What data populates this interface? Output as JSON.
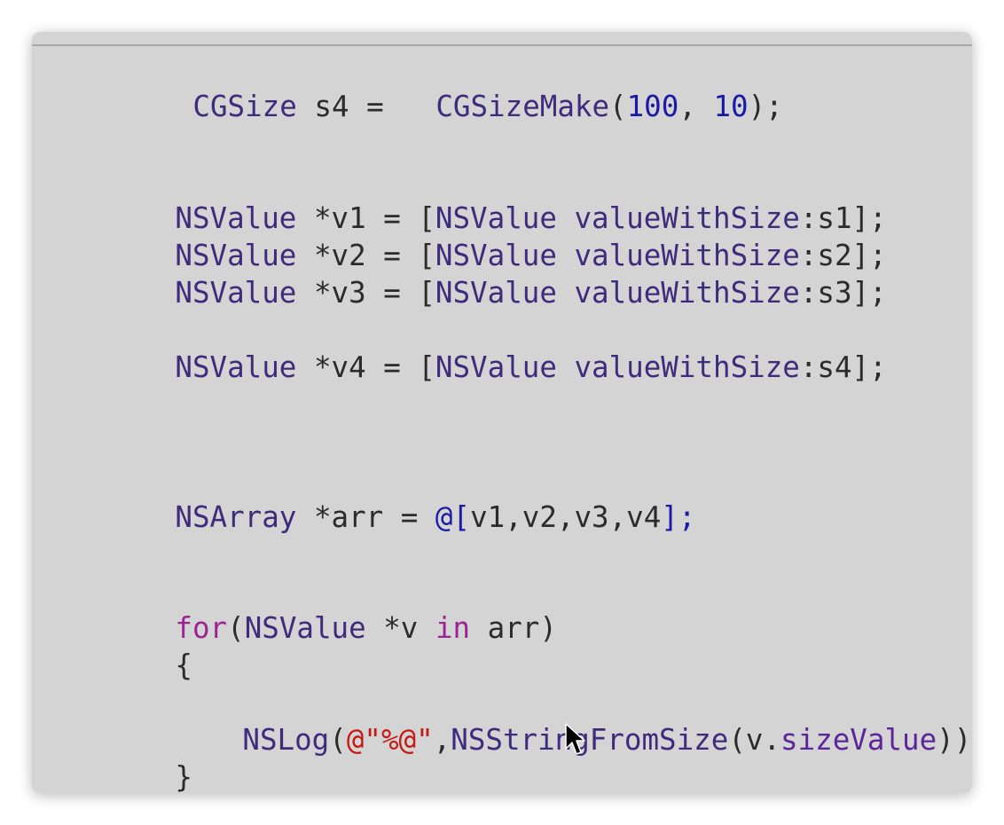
{
  "editor": {
    "lines": {
      "cgsize_decl": {
        "t1": "CGSize",
        "t2": " s4 =   ",
        "t3": "CGSizeMake",
        "t4": "(",
        "t5": "100",
        "t6": ", ",
        "t7": "10",
        "t8": ");"
      },
      "v1_decl": {
        "t1": "NSValue",
        "t2": " *v1 = [",
        "t3": "NSValue",
        "t4": " ",
        "t5": "valueWithSize",
        "t6": ":s1];"
      },
      "v2_decl": {
        "t1": "NSValue",
        "t2": " *v2 = [",
        "t3": "NSValue",
        "t4": " ",
        "t5": "valueWithSize",
        "t6": ":s2];"
      },
      "v3_decl": {
        "t1": "NSValue",
        "t2": " *v3 = [",
        "t3": "NSValue",
        "t4": " ",
        "t5": "valueWithSize",
        "t6": ":s3];"
      },
      "v4_decl": {
        "t1": "NSValue",
        "t2": " *v4 = [",
        "t3": "NSValue",
        "t4": " ",
        "t5": "valueWithSize",
        "t6": ":s4];"
      },
      "arr_decl": {
        "t1": "NSArray",
        "t2": " *arr = ",
        "t3": "@[",
        "t4": "v1,v2,v3,v4",
        "t5": "];"
      },
      "for_stmt": {
        "t1": "for",
        "t2": "(",
        "t3": "NSValue",
        "t4": " *v ",
        "t5": "in",
        "t6": " arr)"
      },
      "open_brace": "{",
      "nslog_stmt": {
        "t1": "NSLog",
        "t2": "(",
        "t3": "@\"%@\"",
        "t4": ",",
        "t5": "NSStringFromSize",
        "t6": "(v.",
        "t7": "sizeValue",
        "t8": "));"
      },
      "close_brace": "}"
    }
  }
}
